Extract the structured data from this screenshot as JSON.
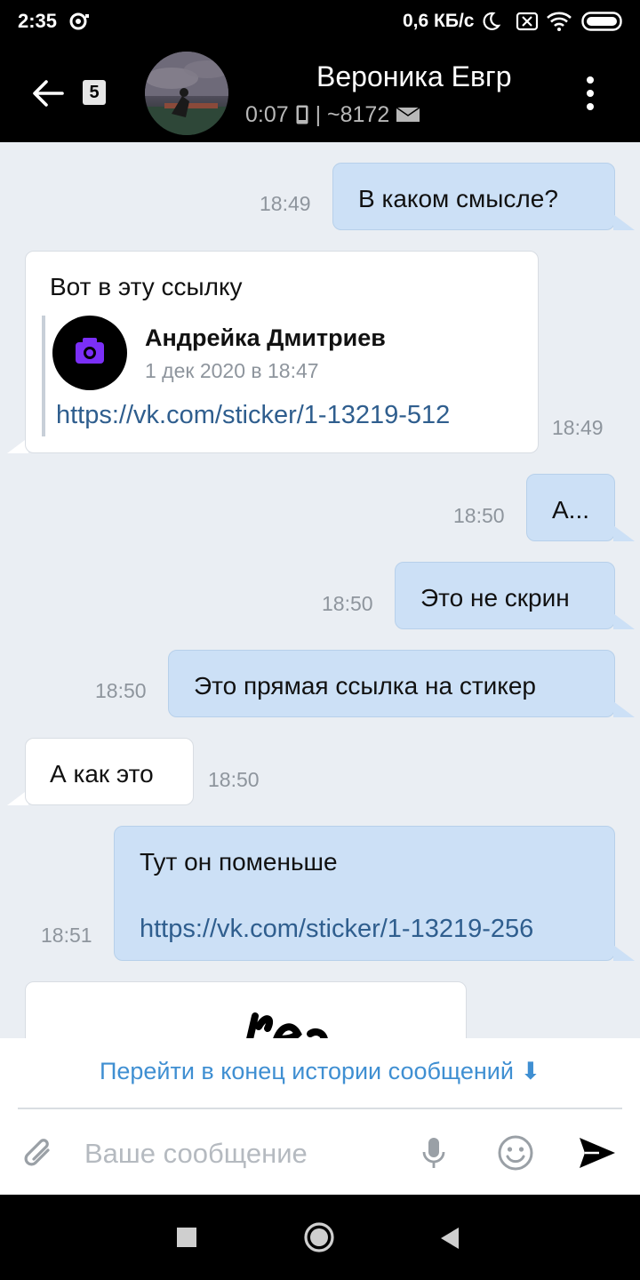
{
  "status_bar": {
    "time": "2:35",
    "speed": "0,6 КБ/с"
  },
  "header": {
    "unread_count": "5",
    "contact_name": "Вероника Евгр",
    "last_seen": "0:07",
    "phone_suffix": "| ~8172"
  },
  "messages": [
    {
      "direction": "out",
      "text": "В каком смысле?",
      "time": "18:49"
    },
    {
      "direction": "in",
      "text": "Вот в эту ссылку",
      "time": "18:49",
      "repost": {
        "author": "Андрейка Дмитриев",
        "date": "1 дек 2020 в 18:47",
        "link": "https://vk.com/sticker/1-13219-512"
      }
    },
    {
      "direction": "out",
      "text": "А...",
      "time": "18:50"
    },
    {
      "direction": "out",
      "text": "Это не скрин",
      "time": "18:50"
    },
    {
      "direction": "out",
      "text": "Это прямая ссылка на стикер",
      "time": "18:50"
    },
    {
      "direction": "in",
      "text": "А как это",
      "time": "18:50"
    },
    {
      "direction": "out",
      "text": "Тут он поменьше",
      "link": "https://vk.com/sticker/1-13219-256",
      "time": "18:51"
    }
  ],
  "jump_to_end": "Перейти в конец истории сообщений ⬇",
  "composer": {
    "placeholder": "Ваше сообщение"
  },
  "colors": {
    "outgoing_bubble": "#cce0f6",
    "incoming_bubble": "#ffffff",
    "chat_background": "#eaeef3",
    "accent": "#3f8fd2",
    "link": "#2f5e8e",
    "repost_avatar_icon": "#7b2ff7"
  },
  "icons": [
    "back-arrow-icon",
    "more-vert-icon",
    "phone-icon",
    "mail-icon",
    "camera-icon",
    "attach-icon",
    "mic-icon",
    "emoji-icon",
    "send-icon"
  ]
}
